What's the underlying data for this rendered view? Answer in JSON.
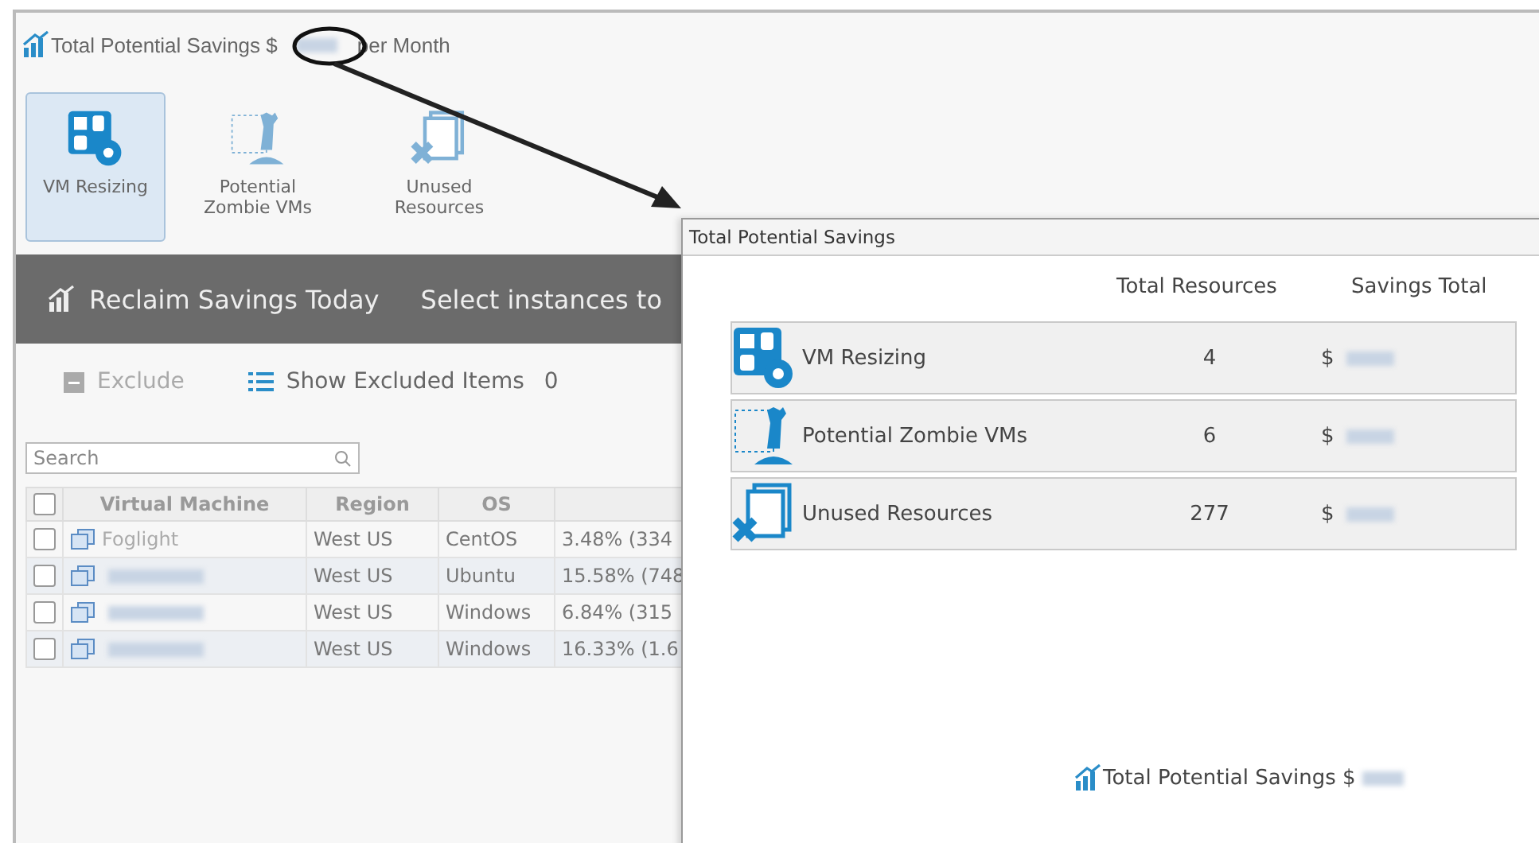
{
  "header": {
    "title_start": "Total Potential Savings $",
    "title_end": "per Month"
  },
  "categories": [
    {
      "label": "VM Resizing",
      "kind": "resize",
      "selected": true
    },
    {
      "label": "Potential Zombie VMs",
      "kind": "zombie",
      "selected": false
    },
    {
      "label": "Unused Resources",
      "kind": "unused",
      "selected": false
    }
  ],
  "banner": {
    "title": "Reclaim Savings Today",
    "subtitle": "Select instances to"
  },
  "actions": {
    "exclude": {
      "label": "Exclude",
      "disabled": true
    },
    "show_excluded": {
      "label": "Show Excluded Items",
      "count": "0"
    }
  },
  "search": {
    "placeholder": "Search"
  },
  "table": {
    "all_checked": false,
    "columns": [
      "Virtual Machine",
      "Region",
      "OS"
    ],
    "rows": [
      {
        "name": "Foglight",
        "region": "West US",
        "os": "CentOS",
        "column_4": "3.48% (334",
        "checked": false
      },
      {
        "name": "",
        "region": "West US",
        "os": "Ubuntu",
        "column_4": "15.58% (748",
        "checked": false
      },
      {
        "name": "",
        "region": "West US",
        "os": "Windows",
        "column_4": "6.84% (315",
        "checked": false
      },
      {
        "name": "",
        "region": "West US",
        "os": "Windows",
        "column_4": "16.33% (1.6",
        "checked": false
      }
    ]
  },
  "dialog": {
    "title": "Total Potential Savings",
    "columns": [
      "Total Resources",
      "Savings Total"
    ],
    "rows": [
      {
        "label": "VM Resizing",
        "kind": "resize",
        "resources": "4",
        "savings": "$"
      },
      {
        "label": "Potential Zombie VMs",
        "kind": "zombie",
        "resources": "6",
        "savings": "$"
      },
      {
        "label": "Unused Resources",
        "kind": "unused",
        "resources": "277",
        "savings": "$"
      }
    ],
    "footer": "Total Potential Savings $"
  }
}
